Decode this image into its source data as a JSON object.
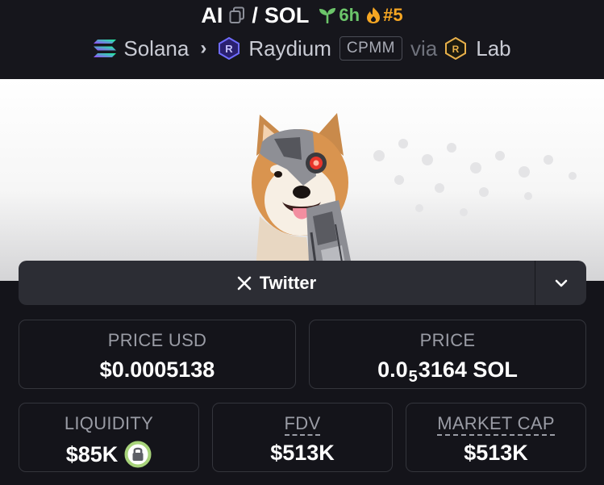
{
  "pair": {
    "base": "AI",
    "separator": "/",
    "quote": "SOL"
  },
  "age": {
    "value": "6h",
    "icon": "seedling-icon",
    "color": "#6cc56a"
  },
  "trending": {
    "rank": "#5",
    "icon": "flame-icon",
    "color": "#f5a623"
  },
  "meta": {
    "chain": "Solana",
    "dex": "Raydium",
    "pool_type": "CPMM",
    "via": "via",
    "launchpad": "Lab"
  },
  "social": {
    "twitter_label": "Twitter"
  },
  "stats": {
    "price_usd": {
      "label": "PRICE USD",
      "value": "$0.0005138"
    },
    "price_native": {
      "label": "PRICE",
      "prefix": "0.0",
      "zeros": "5",
      "digits": "3164 SOL"
    },
    "liquidity": {
      "label": "LIQUIDITY",
      "value": "$85K",
      "locked": true
    },
    "fdv": {
      "label": "FDV",
      "value": "$513K"
    },
    "market_cap": {
      "label": "MARKET CAP",
      "value": "$513K"
    }
  },
  "colors": {
    "accent_green": "#6cc56a",
    "accent_orange": "#f5a623",
    "lock_ring": "#a7d37a"
  }
}
